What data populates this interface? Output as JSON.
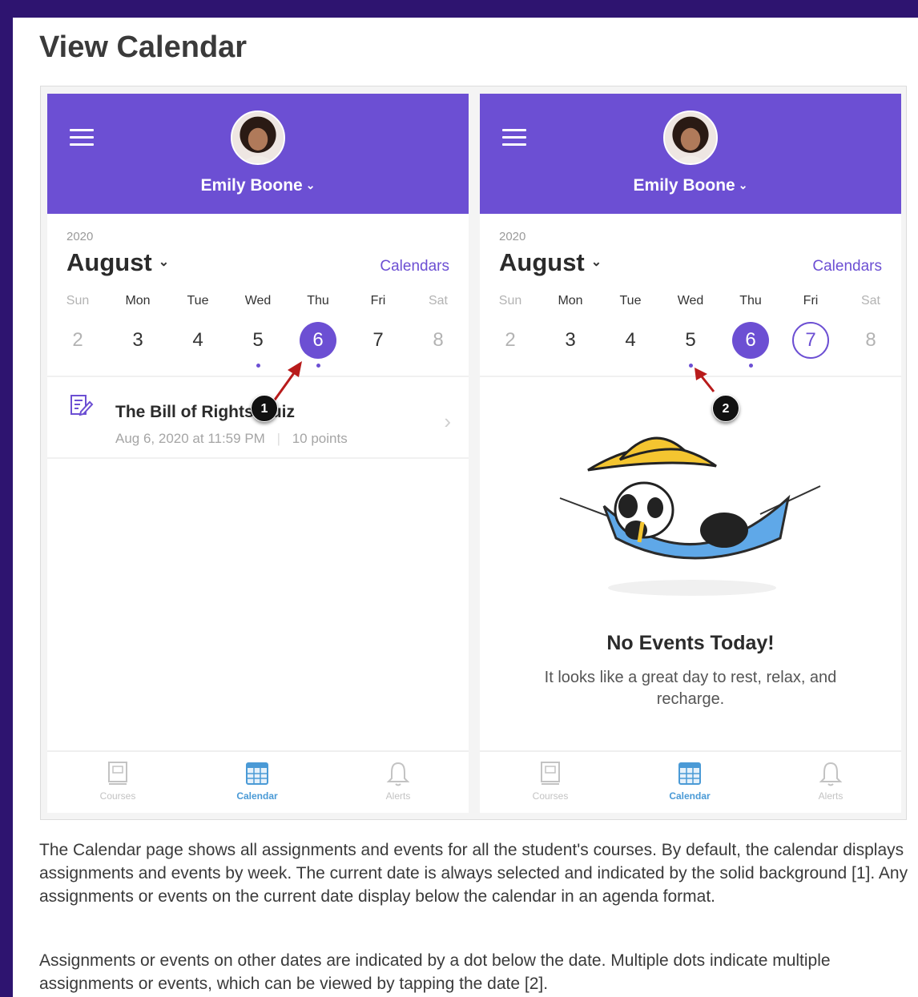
{
  "page": {
    "title": "View Calendar",
    "paragraphs": [
      "The Calendar page shows all assignments and events for all the student's courses. By default, the calendar displays assignments and events by week. The current date is always selected and indicated by the solid background [1]. Any assignments or events on the current date display below the calendar in an agenda format.",
      "Assignments or events on other dates are indicated by a dot below the date. Multiple dots indicate multiple assignments or events, which can be viewed by tapping the date [2]."
    ]
  },
  "colors": {
    "brand_purple": "#6c4fd3",
    "background_frame": "#2e1470",
    "tab_active": "#4a9ad6",
    "annotation_arrow": "#b81b1b"
  },
  "screens": [
    {
      "header": {
        "user_name": "Emily Boone",
        "menu_icon": "hamburger-icon",
        "chevron_icon": "chevron-down-icon"
      },
      "calendar": {
        "year": "2020",
        "month": "August",
        "calendars_link": "Calendars",
        "weekdays": [
          "Sun",
          "Mon",
          "Tue",
          "Wed",
          "Thu",
          "Fri",
          "Sat"
        ],
        "dates": [
          "2",
          "3",
          "4",
          "5",
          "6",
          "7",
          "8"
        ],
        "selected_date": "6",
        "dot_dates": [
          "5",
          "6"
        ]
      },
      "event": {
        "title": "The Bill of Rights Quiz",
        "date": "Aug 6, 2020 at 11:59 PM",
        "separator": "|",
        "points": "10 points",
        "icon": "quiz-icon"
      },
      "annotation": {
        "number": "1"
      },
      "tabs": [
        {
          "label": "Courses",
          "icon": "courses-icon",
          "active": false
        },
        {
          "label": "Calendar",
          "icon": "calendar-icon",
          "active": true
        },
        {
          "label": "Alerts",
          "icon": "bell-icon",
          "active": false
        }
      ]
    },
    {
      "header": {
        "user_name": "Emily Boone",
        "menu_icon": "hamburger-icon",
        "chevron_icon": "chevron-down-icon"
      },
      "calendar": {
        "year": "2020",
        "month": "August",
        "calendars_link": "Calendars",
        "weekdays": [
          "Sun",
          "Mon",
          "Tue",
          "Wed",
          "Thu",
          "Fri",
          "Sat"
        ],
        "dates": [
          "2",
          "3",
          "4",
          "5",
          "6",
          "7",
          "8"
        ],
        "selected_date": "7",
        "today_date": "6",
        "dot_dates": [
          "5",
          "6"
        ]
      },
      "empty_state": {
        "title": "No Events Today!",
        "message": "It looks like a great day to rest, relax, and recharge.",
        "illustration": "panda-hammock-illustration"
      },
      "annotation": {
        "number": "2"
      },
      "tabs": [
        {
          "label": "Courses",
          "icon": "courses-icon",
          "active": false
        },
        {
          "label": "Calendar",
          "icon": "calendar-icon",
          "active": true
        },
        {
          "label": "Alerts",
          "icon": "bell-icon",
          "active": false
        }
      ]
    }
  ]
}
